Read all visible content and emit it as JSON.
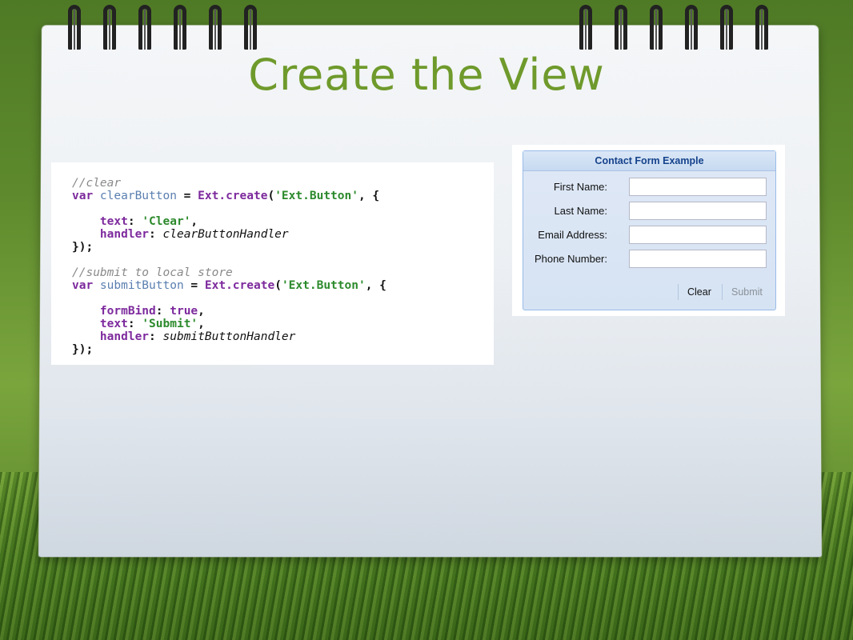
{
  "slide": {
    "title": "Create the View"
  },
  "code": {
    "lines": [
      [
        {
          "t": "//clear",
          "c": "c-comment"
        }
      ],
      [
        {
          "t": "var ",
          "c": "c-kw"
        },
        {
          "t": "clearButton",
          "c": "c-var"
        },
        {
          "t": " = ",
          "c": "c-p"
        },
        {
          "t": "Ext.create",
          "c": "c-kw"
        },
        {
          "t": "(",
          "c": "c-p"
        },
        {
          "t": "'Ext.Button'",
          "c": "c-str"
        },
        {
          "t": ", {",
          "c": "c-p"
        }
      ],
      [],
      [
        {
          "t": "    text",
          "c": "c-prop"
        },
        {
          "t": ": ",
          "c": "c-p"
        },
        {
          "t": "'Clear'",
          "c": "c-str"
        },
        {
          "t": ",",
          "c": "c-p"
        }
      ],
      [
        {
          "t": "    handler",
          "c": "c-prop"
        },
        {
          "t": ": ",
          "c": "c-p"
        },
        {
          "t": "clearButtonHandler",
          "c": "c-id"
        }
      ],
      [
        {
          "t": "});",
          "c": "c-p"
        }
      ],
      [],
      [
        {
          "t": "//submit to local store",
          "c": "c-comment"
        }
      ],
      [
        {
          "t": "var ",
          "c": "c-kw"
        },
        {
          "t": "submitButton",
          "c": "c-var"
        },
        {
          "t": " = ",
          "c": "c-p"
        },
        {
          "t": "Ext.create",
          "c": "c-kw"
        },
        {
          "t": "(",
          "c": "c-p"
        },
        {
          "t": "'Ext.Button'",
          "c": "c-str"
        },
        {
          "t": ", {",
          "c": "c-p"
        }
      ],
      [],
      [
        {
          "t": "    formBind",
          "c": "c-prop"
        },
        {
          "t": ": ",
          "c": "c-p"
        },
        {
          "t": "true",
          "c": "c-kw"
        },
        {
          "t": ",",
          "c": "c-p"
        }
      ],
      [
        {
          "t": "    text",
          "c": "c-prop"
        },
        {
          "t": ": ",
          "c": "c-p"
        },
        {
          "t": "'Submit'",
          "c": "c-str"
        },
        {
          "t": ",",
          "c": "c-p"
        }
      ],
      [
        {
          "t": "    handler",
          "c": "c-prop"
        },
        {
          "t": ": ",
          "c": "c-p"
        },
        {
          "t": "submitButtonHandler",
          "c": "c-id"
        }
      ],
      [
        {
          "t": "});",
          "c": "c-p"
        }
      ]
    ]
  },
  "form": {
    "title": "Contact Form Example",
    "fields": [
      {
        "label": "First Name:",
        "value": ""
      },
      {
        "label": "Last Name:",
        "value": ""
      },
      {
        "label": "Email Address:",
        "value": ""
      },
      {
        "label": "Phone Number:",
        "value": ""
      }
    ],
    "clear_label": "Clear",
    "submit_label": "Submit"
  },
  "colors": {
    "title": "#6f9a2c",
    "panel_header_text": "#15428b",
    "panel_border": "#99bbe8"
  }
}
